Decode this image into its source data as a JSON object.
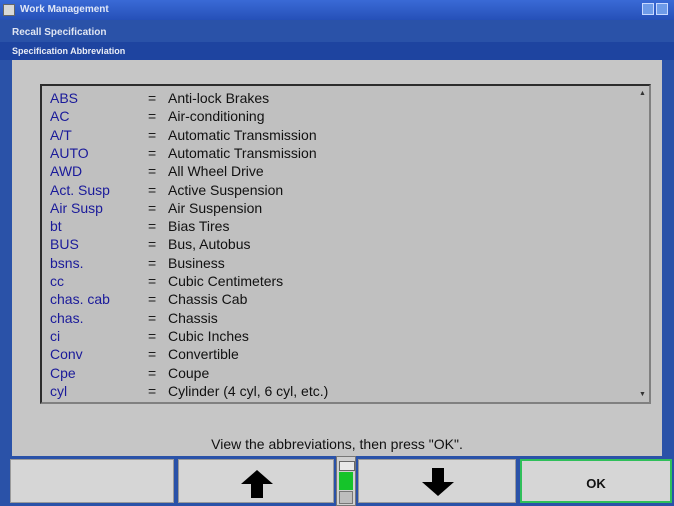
{
  "window": {
    "title": "Work Management",
    "subtitle": "Recall Specification",
    "section": "Specification Abbreviation"
  },
  "abbreviations": [
    {
      "abbr": "ABS",
      "def": "Anti-lock Brakes"
    },
    {
      "abbr": "AC",
      "def": "Air-conditioning"
    },
    {
      "abbr": "A/T",
      "def": "Automatic Transmission"
    },
    {
      "abbr": "AUTO",
      "def": "Automatic Transmission"
    },
    {
      "abbr": "AWD",
      "def": "All Wheel Drive"
    },
    {
      "abbr": "Act. Susp",
      "def": "Active Suspension"
    },
    {
      "abbr": "Air Susp",
      "def": "Air Suspension"
    },
    {
      "abbr": "bt",
      "def": "Bias Tires"
    },
    {
      "abbr": "BUS",
      "def": "Bus, Autobus"
    },
    {
      "abbr": "bsns.",
      "def": "Business"
    },
    {
      "abbr": "cc",
      "def": "Cubic Centimeters"
    },
    {
      "abbr": "chas. cab",
      "def": "Chassis Cab"
    },
    {
      "abbr": "chas.",
      "def": "Chassis"
    },
    {
      "abbr": "ci",
      "def": "Cubic Inches"
    },
    {
      "abbr": "Conv",
      "def": "Convertible"
    },
    {
      "abbr": "Cpe",
      "def": "Coupe"
    },
    {
      "abbr": "cyl",
      "def": "Cylinder (4 cyl, 6 cyl, etc.)"
    }
  ],
  "separator": "=",
  "instruction": "View the abbreviations, then press \"OK\".",
  "softkeys": {
    "scroll_up_icon": "up-arrow-icon",
    "scroll_down_icon": "down-arrow-icon",
    "ok_label": "OK"
  },
  "colors": {
    "accent": "#2a52a8",
    "abbr_text": "#1a1a9a",
    "ok_border": "#2fbf5a",
    "meter_fill": "#15c42a"
  }
}
